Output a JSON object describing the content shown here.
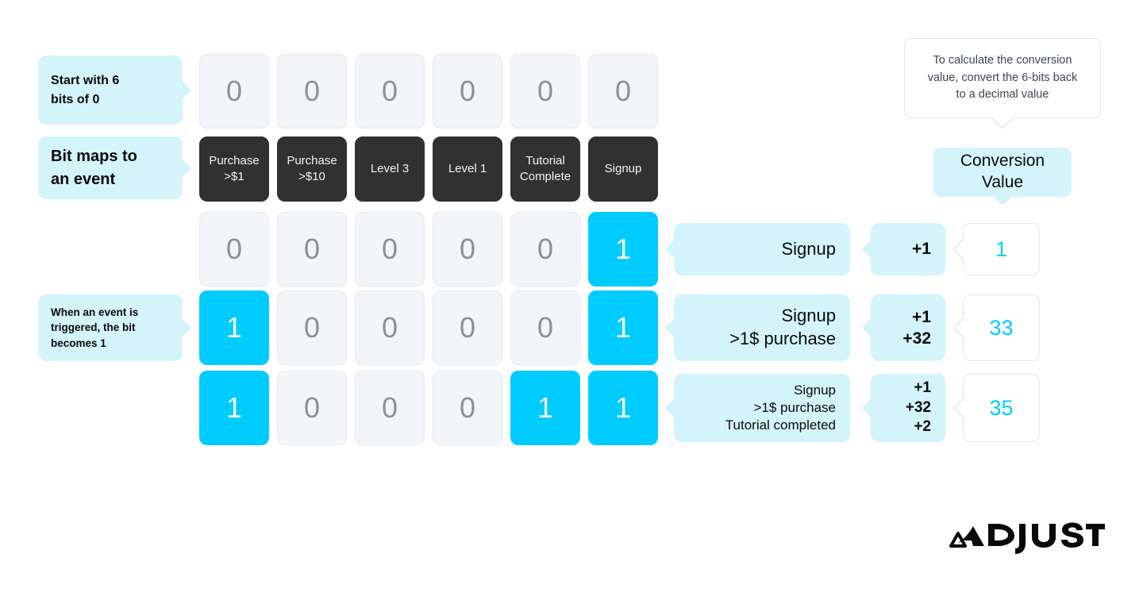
{
  "accent_colors": {
    "bit_on": "#00ccff",
    "callout_bg": "#d3f4fb",
    "event_bg": "#313131",
    "bit_off_bg": "#f3f5f8",
    "value_text": "#00ccff"
  },
  "callouts": [
    {
      "id": "start-bits",
      "lines": [
        "Start with 6",
        "bits of 0"
      ]
    },
    {
      "id": "bit-maps",
      "lines": [
        "Bit maps to",
        "an event"
      ]
    },
    {
      "id": "event-trigger",
      "lines": [
        "When an event is",
        "triggered, the bit",
        "becomes 1"
      ]
    }
  ],
  "tooltip": {
    "lines": [
      "To calculate the conversion",
      "value, convert the 6-bits back",
      "to a decimal value"
    ]
  },
  "conversion_value_header": {
    "lines": [
      "Conversion",
      "Value"
    ]
  },
  "event_labels": [
    {
      "lines": [
        "Purchase",
        ">$1"
      ]
    },
    {
      "lines": [
        "Purchase",
        ">$10"
      ]
    },
    {
      "lines": [
        "Level 3"
      ]
    },
    {
      "lines": [
        "Level 1"
      ]
    },
    {
      "lines": [
        "Tutorial",
        "Complete"
      ]
    },
    {
      "lines": [
        "Signup"
      ]
    }
  ],
  "bit_rows": [
    {
      "id": "initial",
      "bits": [
        "0",
        "0",
        "0",
        "0",
        "0",
        "0"
      ]
    },
    {
      "id": "signup",
      "bits": [
        "0",
        "0",
        "0",
        "0",
        "0",
        "1"
      ]
    },
    {
      "id": "signup-purchase",
      "bits": [
        "1",
        "0",
        "0",
        "0",
        "0",
        "1"
      ]
    },
    {
      "id": "signup-purchase-tutorial",
      "bits": [
        "1",
        "0",
        "0",
        "0",
        "1",
        "1"
      ]
    }
  ],
  "result_rows": [
    {
      "events": [
        "Signup"
      ],
      "increments": [
        "+1"
      ],
      "value": "1"
    },
    {
      "events": [
        "Signup",
        ">1$ purchase"
      ],
      "increments": [
        "+1",
        "+32"
      ],
      "value": "33"
    },
    {
      "events": [
        "Signup",
        ">1$ purchase",
        "Tutorial completed"
      ],
      "increments": [
        "+1",
        "+32",
        "+2"
      ],
      "value": "35"
    }
  ],
  "logo": {
    "text": "ADJUST"
  }
}
